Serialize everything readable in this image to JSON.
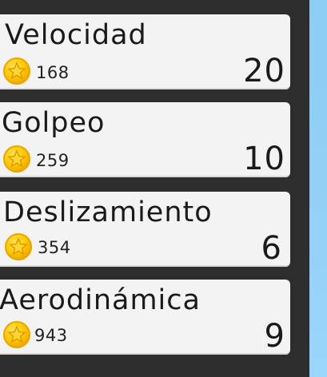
{
  "upgrades": [
    {
      "title": "Velocidad",
      "cost": "168",
      "level": "20"
    },
    {
      "title": "Golpeo",
      "cost": "259",
      "level": "10"
    },
    {
      "title": "Deslizamiento",
      "cost": "354",
      "level": "6"
    },
    {
      "title": "Aerodinámica",
      "cost": "943",
      "level": "9"
    }
  ],
  "colors": {
    "card": "#f3f3f3",
    "panel": "#2d2d2d",
    "coin": "#ffcc00",
    "sky": "#93d0f6"
  },
  "icons": {
    "coin": "star-coin-icon"
  }
}
